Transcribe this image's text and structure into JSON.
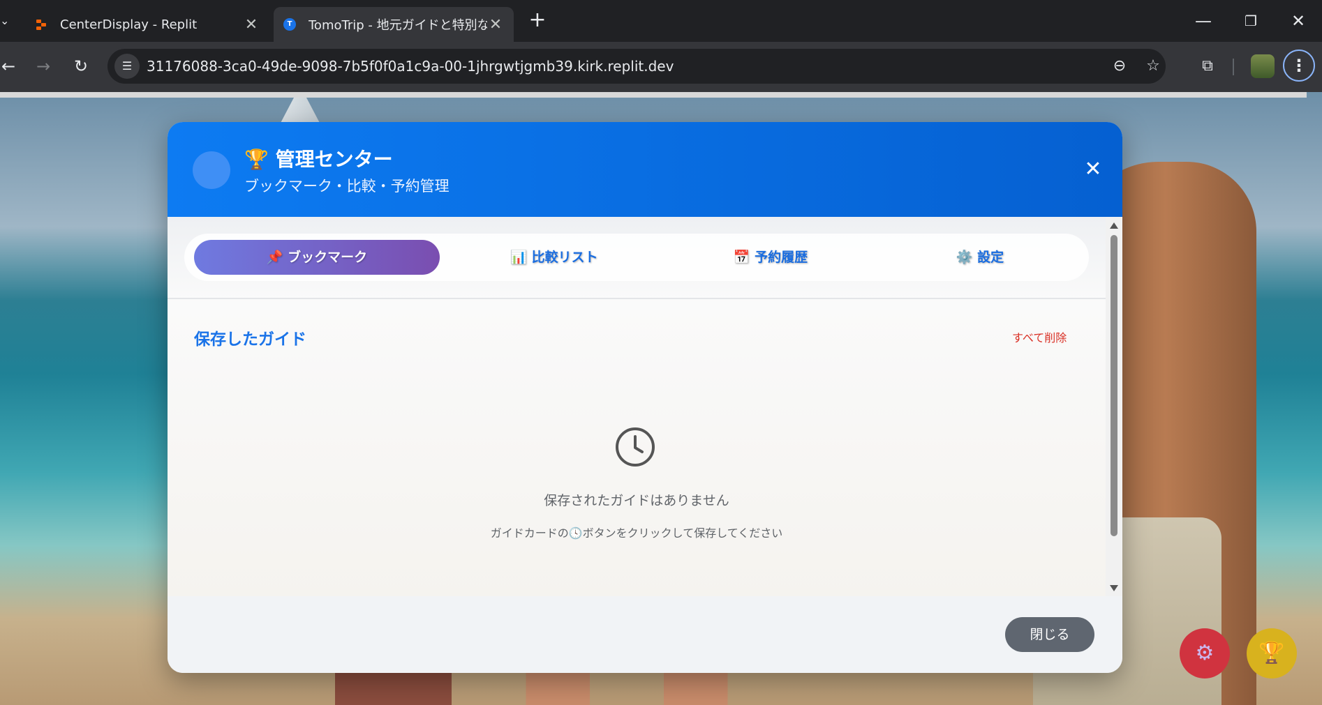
{
  "browser": {
    "tabs": [
      {
        "title": "CenterDisplay - Replit",
        "active": false
      },
      {
        "title": "TomoTrip - 地元ガイドと特別な旅",
        "active": true
      }
    ],
    "new_tab": "+",
    "url": "31176088-3ca0-49de-9098-7b5f0f0a1c9a-00-1jhrgwtjgmb39.kirk.replit.dev",
    "icons": {
      "tab_menu": "chevron-down-icon",
      "close_tab": "close-icon",
      "minimize": "minimize-icon",
      "restore": "restore-icon",
      "close_window": "close-icon",
      "back": "arrow-left-icon",
      "forward": "arrow-right-icon",
      "reload": "reload-icon",
      "site_info": "tune-icon",
      "zoom": "zoom-out-icon",
      "bookmark": "star-icon",
      "extensions": "puzzle-icon",
      "menu": "more-vert-icon"
    }
  },
  "modal": {
    "title": "🏆 管理センター",
    "subtitle": "ブックマーク・比較・予約管理",
    "tabs": [
      {
        "label": "📌 ブックマーク",
        "active": true
      },
      {
        "label": "📊 比較リスト",
        "active": false
      },
      {
        "label": "📅 予約履歴",
        "active": false
      },
      {
        "label": "⚙️ 設定",
        "active": false
      }
    ],
    "section_title": "保存したガイド",
    "delete_all": "すべて削除",
    "empty_message": "保存されたガイドはありません",
    "empty_hint": "ガイドカードの🕓ボタンをクリックして保存してください",
    "close_button": "閉じる"
  },
  "floating_buttons": [
    {
      "name": "settings",
      "icon": "⚙",
      "color": "#d0333f"
    },
    {
      "name": "trophy",
      "icon": "🏆",
      "color": "#d8b21e"
    }
  ],
  "colors": {
    "header_blue": "#0d7bf2",
    "active_tab_start": "#6f7ae0",
    "active_tab_end": "#7a4eb0",
    "link_blue": "#1a73e8",
    "danger_red": "#d93025",
    "close_button": "#5f6670"
  }
}
